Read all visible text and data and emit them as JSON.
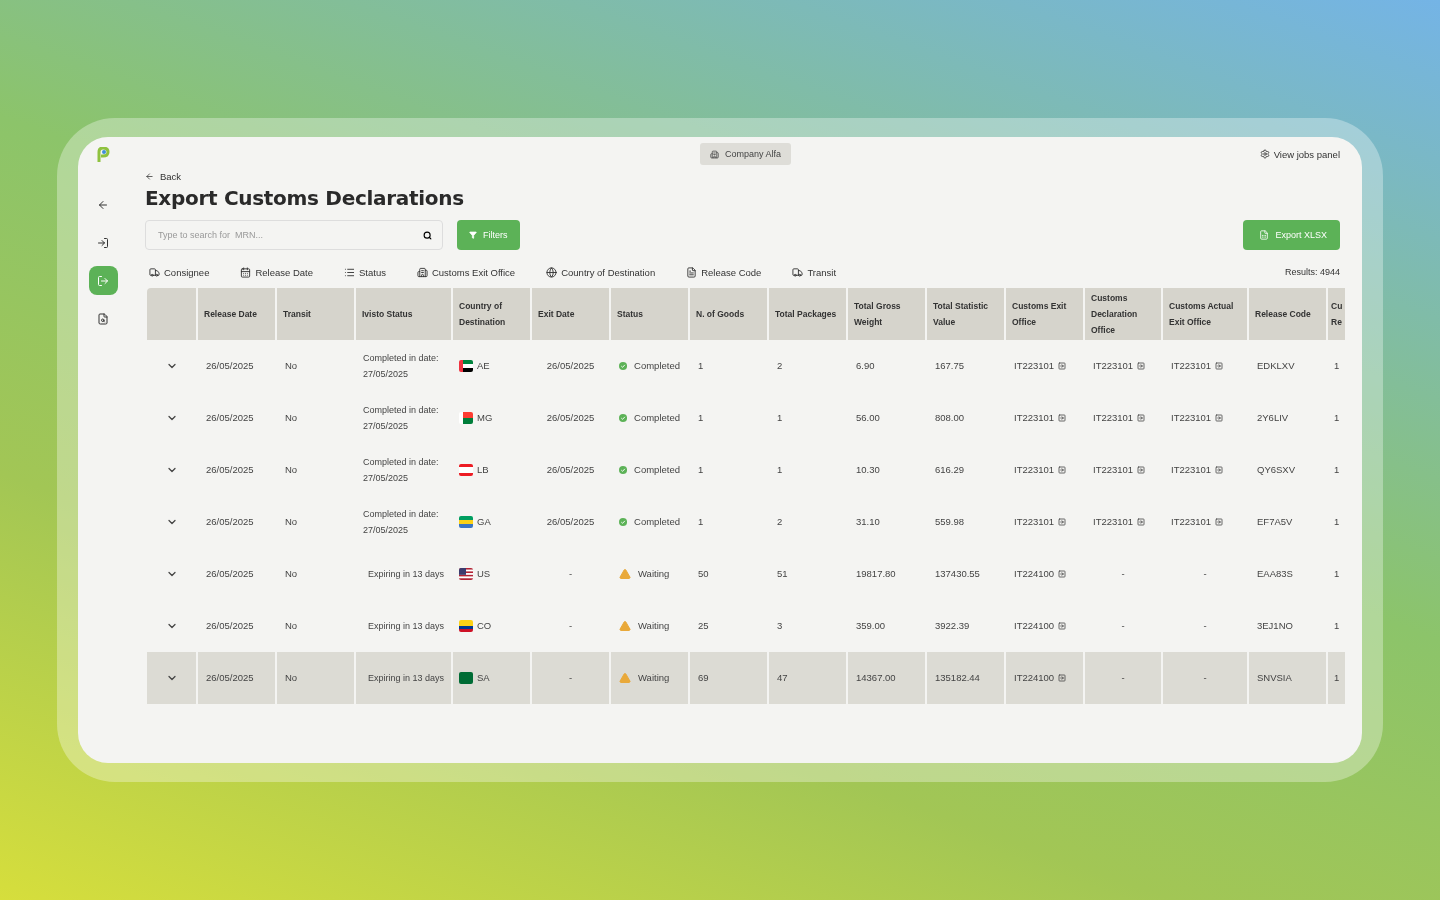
{
  "company": {
    "label": "Company Alfa"
  },
  "jobs_link": "View jobs panel",
  "sidebar": {
    "items": [
      {
        "kind": "back",
        "selected": false
      },
      {
        "kind": "import",
        "selected": false
      },
      {
        "kind": "export",
        "selected": true
      },
      {
        "kind": "search",
        "selected": false
      }
    ]
  },
  "back_link": "Back",
  "title": "Export Customs Declarations",
  "search": {
    "placeholder": "Type to search for  MRN..."
  },
  "filters_button": "Filters",
  "export_button": "Export XLSX",
  "filter_chips": [
    {
      "kind": "truck",
      "label": "Consignee"
    },
    {
      "kind": "calendar",
      "label": "Release Date"
    },
    {
      "kind": "list",
      "label": "Status"
    },
    {
      "kind": "building",
      "label": "Customs Exit Office"
    },
    {
      "kind": "globe",
      "label": "Country of Destination"
    },
    {
      "kind": "document",
      "label": "Release Code"
    },
    {
      "kind": "truck",
      "label": "Transit"
    }
  ],
  "results": "Results: 4944",
  "table": {
    "columns": [
      "",
      "Release Date",
      "Transit",
      "Ivisto Status",
      "Country of Destination",
      "Exit Date",
      "Status",
      "N. of Goods",
      "Total Packages",
      "Total Gross Weight",
      "Total Statistic Value",
      "Customs Exit Office",
      "Customs Declaration Office",
      "Customs Actual Exit Office",
      "Release Code",
      "Cu Re"
    ],
    "rows": [
      {
        "selected": false,
        "release_date": "26/05/2025",
        "transit": "No",
        "ivisto_status": {
          "kind": "completed",
          "text": "Completed in date: 27/05/2025"
        },
        "country": {
          "code": "AE",
          "kind": "ae"
        },
        "exit_date": "26/05/2025",
        "status": {
          "kind": "completed",
          "label": "Completed"
        },
        "goods": "1",
        "packages": "2",
        "gross_weight": "6.90",
        "statistic_value": "167.75",
        "exit_office": {
          "value": "IT223101",
          "linked": true
        },
        "declaration_office": {
          "value": "IT223101",
          "linked": true
        },
        "actual_exit_office": {
          "value": "IT223101",
          "linked": true
        },
        "release_code": "EDKLXV",
        "column_16": "1"
      },
      {
        "selected": false,
        "release_date": "26/05/2025",
        "transit": "No",
        "ivisto_status": {
          "kind": "completed",
          "text": "Completed in date: 27/05/2025"
        },
        "country": {
          "code": "MG",
          "kind": "mg"
        },
        "exit_date": "26/05/2025",
        "status": {
          "kind": "completed",
          "label": "Completed"
        },
        "goods": "1",
        "packages": "1",
        "gross_weight": "56.00",
        "statistic_value": "808.00",
        "exit_office": {
          "value": "IT223101",
          "linked": true
        },
        "declaration_office": {
          "value": "IT223101",
          "linked": true
        },
        "actual_exit_office": {
          "value": "IT223101",
          "linked": true
        },
        "release_code": "2Y6LIV",
        "column_16": "1"
      },
      {
        "selected": false,
        "release_date": "26/05/2025",
        "transit": "No",
        "ivisto_status": {
          "kind": "completed",
          "text": "Completed in date: 27/05/2025"
        },
        "country": {
          "code": "LB",
          "kind": "lb"
        },
        "exit_date": "26/05/2025",
        "status": {
          "kind": "completed",
          "label": "Completed"
        },
        "goods": "1",
        "packages": "1",
        "gross_weight": "10.30",
        "statistic_value": "616.29",
        "exit_office": {
          "value": "IT223101",
          "linked": true
        },
        "declaration_office": {
          "value": "IT223101",
          "linked": true
        },
        "actual_exit_office": {
          "value": "IT223101",
          "linked": true
        },
        "release_code": "QY6SXV",
        "column_16": "1"
      },
      {
        "selected": false,
        "release_date": "26/05/2025",
        "transit": "No",
        "ivisto_status": {
          "kind": "completed",
          "text": "Completed in date: 27/05/2025"
        },
        "country": {
          "code": "GA",
          "kind": "ga"
        },
        "exit_date": "26/05/2025",
        "status": {
          "kind": "completed",
          "label": "Completed"
        },
        "goods": "1",
        "packages": "2",
        "gross_weight": "31.10",
        "statistic_value": "559.98",
        "exit_office": {
          "value": "IT223101",
          "linked": true
        },
        "declaration_office": {
          "value": "IT223101",
          "linked": true
        },
        "actual_exit_office": {
          "value": "IT223101",
          "linked": true
        },
        "release_code": "EF7A5V",
        "column_16": "1"
      },
      {
        "selected": false,
        "release_date": "26/05/2025",
        "transit": "No",
        "ivisto_status": {
          "kind": "expiring",
          "text": "Expiring in 13 days"
        },
        "country": {
          "code": "US",
          "kind": "us"
        },
        "exit_date": "-",
        "status": {
          "kind": "waiting",
          "label": "Waiting"
        },
        "goods": "50",
        "packages": "51",
        "gross_weight": "19817.80",
        "statistic_value": "137430.55",
        "exit_office": {
          "value": "IT224100",
          "linked": true
        },
        "declaration_office": {
          "value": "-",
          "linked": false
        },
        "actual_exit_office": {
          "value": "-",
          "linked": false
        },
        "release_code": "EAA83S",
        "column_16": "1"
      },
      {
        "selected": false,
        "release_date": "26/05/2025",
        "transit": "No",
        "ivisto_status": {
          "kind": "expiring",
          "text": "Expiring in 13 days"
        },
        "country": {
          "code": "CO",
          "kind": "co"
        },
        "exit_date": "-",
        "status": {
          "kind": "waiting",
          "label": "Waiting"
        },
        "goods": "25",
        "packages": "3",
        "gross_weight": "359.00",
        "statistic_value": "3922.39",
        "exit_office": {
          "value": "IT224100",
          "linked": true
        },
        "declaration_office": {
          "value": "-",
          "linked": false
        },
        "actual_exit_office": {
          "value": "-",
          "linked": false
        },
        "release_code": "3EJ1NO",
        "column_16": "1"
      },
      {
        "selected": true,
        "release_date": "26/05/2025",
        "transit": "No",
        "ivisto_status": {
          "kind": "expiring",
          "text": "Expiring in 13 days"
        },
        "country": {
          "code": "SA",
          "kind": "sa"
        },
        "exit_date": "-",
        "status": {
          "kind": "waiting",
          "label": "Waiting"
        },
        "goods": "69",
        "packages": "47",
        "gross_weight": "14367.00",
        "statistic_value": "135182.44",
        "exit_office": {
          "value": "IT224100",
          "linked": true
        },
        "declaration_office": {
          "value": "-",
          "linked": false
        },
        "actual_exit_office": {
          "value": "-",
          "linked": false
        },
        "release_code": "SNVSIA",
        "column_16": "1"
      }
    ]
  }
}
